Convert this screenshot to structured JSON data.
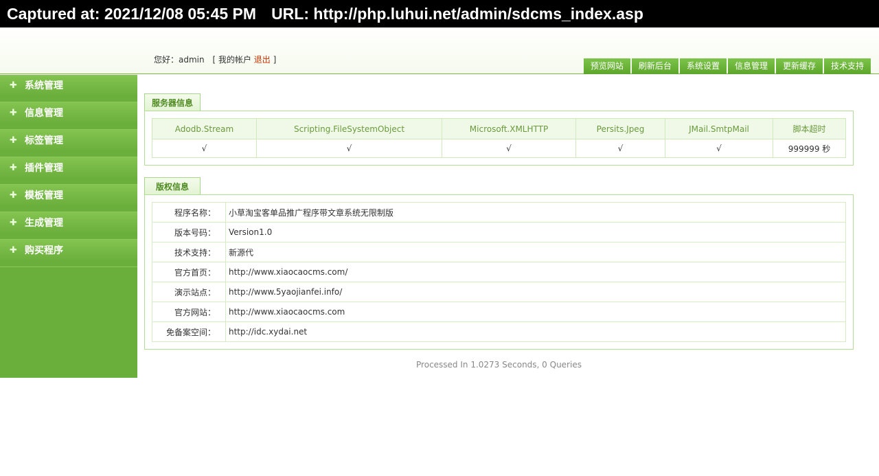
{
  "capture": {
    "captured": "Captured at: 2021/12/08 05:45 PM",
    "url": "URL: http://php.luhui.net/admin/sdcms_index.asp"
  },
  "header": {
    "greeting": "您好：admin",
    "bracket_open": "[",
    "account": "我的帐户",
    "logout": "退出",
    "bracket_close": "]",
    "nav": [
      "预览网站",
      "刷新后台",
      "系统设置",
      "信息管理",
      "更新缓存",
      "技术支持"
    ]
  },
  "sidebar": {
    "items": [
      "系统管理",
      "信息管理",
      "标签管理",
      "插件管理",
      "模板管理",
      "生成管理",
      "购买程序"
    ]
  },
  "server": {
    "tab": "服务器信息",
    "headers": [
      "Adodb.Stream",
      "Scripting.FileSystemObject",
      "Microsoft.XMLHTTP",
      "Persits.Jpeg",
      "JMail.SmtpMail",
      "脚本超时"
    ],
    "values": [
      "√",
      "√",
      "√",
      "√",
      "√",
      "999999 秒"
    ]
  },
  "copyright": {
    "tab": "版权信息",
    "rows": [
      {
        "k": "程序名称：",
        "v": "小草淘宝客单品推广程序带文章系统无限制版"
      },
      {
        "k": "版本号码：",
        "v": "Version1.0"
      },
      {
        "k": "技术支持：",
        "v": "新源代"
      },
      {
        "k": "官方首页：",
        "v": "http://www.xiaocaocms.com/"
      },
      {
        "k": "演示站点：",
        "v": "http://www.5yaojianfei.info/"
      },
      {
        "k": "官方网站：",
        "v": "http://www.xiaocaocms.com"
      },
      {
        "k": "免备案空间：",
        "v": "http://idc.xydai.net"
      }
    ]
  },
  "footer": "Processed In 1.0273 Seconds, 0 Queries",
  "colors": {
    "accent": "#6aae3c",
    "logout": "#cc3300"
  }
}
